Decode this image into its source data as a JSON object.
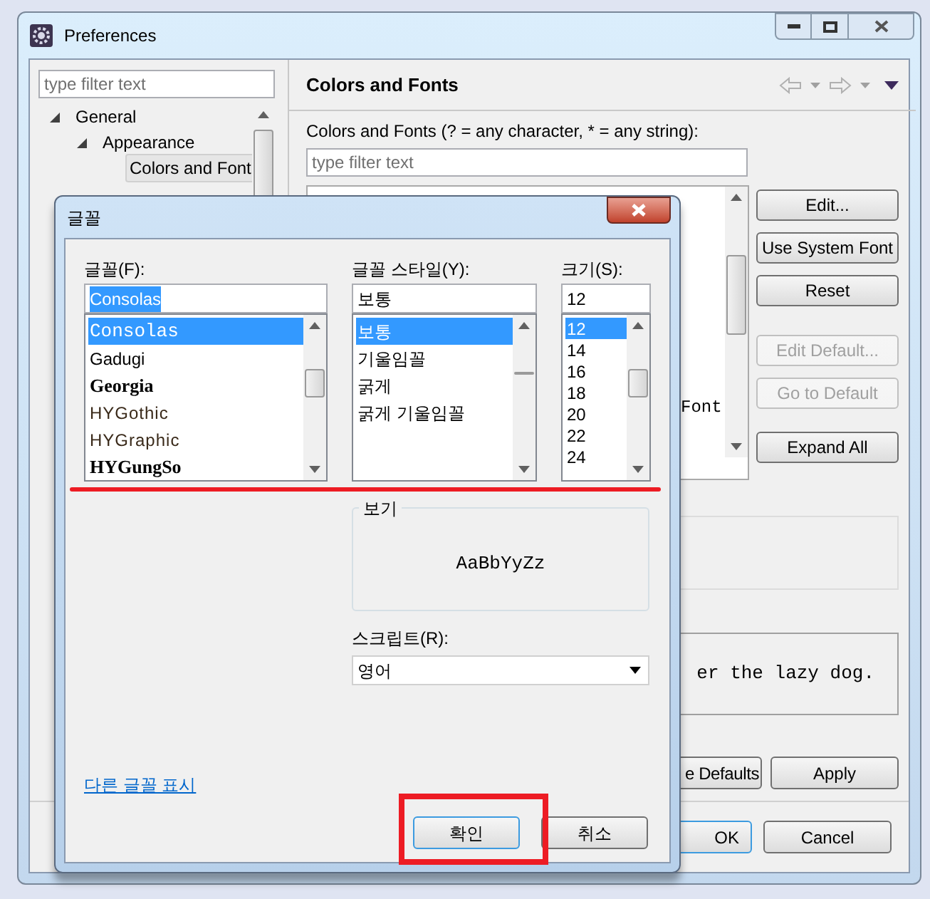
{
  "window": {
    "title": "Preferences"
  },
  "sidebar": {
    "filter_placeholder": "type filter text",
    "tree": [
      {
        "label": "General",
        "expanded": true,
        "selected": false,
        "children": [
          {
            "label": "Appearance",
            "expanded": true,
            "selected": false,
            "children": [
              {
                "label": "Colors and Font",
                "selected": true
              }
            ]
          }
        ]
      }
    ]
  },
  "page": {
    "title": "Colors and Fonts",
    "filter_label": "Colors and Fonts (? = any character, * = any string):",
    "filter_placeholder": "type filter text",
    "tree_fragment": "Font",
    "side_buttons": [
      {
        "label": "Edit...",
        "disabled": false
      },
      {
        "label": "Use System Font",
        "disabled": false
      },
      {
        "label": "Reset",
        "disabled": false
      },
      {
        "label": "Edit Default...",
        "disabled": true
      },
      {
        "label": "Go to Default",
        "disabled": true
      },
      {
        "label": "Expand All",
        "disabled": false
      }
    ],
    "preview_text": "er the lazy dog.",
    "footer_buttons": [
      {
        "label": "e Defaults",
        "default": false
      },
      {
        "label": "Apply",
        "default": false
      }
    ],
    "dialog_buttons": [
      {
        "label": "OK",
        "default": true
      },
      {
        "label": "Cancel",
        "default": false
      }
    ]
  },
  "font_dialog": {
    "title": "글꼴",
    "columns": [
      {
        "label": "글꼴(F):",
        "value": "Consolas",
        "value_selected": true,
        "items": [
          {
            "label": "Consolas",
            "kind": "mono",
            "selected": true
          },
          {
            "label": "Gadugi",
            "kind": "sans",
            "selected": false
          },
          {
            "label": "Georgia",
            "kind": "serif-bold",
            "selected": false
          },
          {
            "label": "HYGothic",
            "kind": "wide",
            "selected": false
          },
          {
            "label": "HYGraphic",
            "kind": "wide",
            "selected": false
          },
          {
            "label": "HYGungSo",
            "kind": "serif-bold",
            "selected": false
          }
        ]
      },
      {
        "label": "글꼴 스타일(Y):",
        "value": "보통",
        "value_selected": false,
        "items": [
          {
            "label": "보통",
            "kind": "sans",
            "selected": true
          },
          {
            "label": "기울임꼴",
            "kind": "sans",
            "selected": false
          },
          {
            "label": "굵게",
            "kind": "sans",
            "selected": false
          },
          {
            "label": "굵게 기울임꼴",
            "kind": "sans",
            "selected": false
          }
        ]
      },
      {
        "label": "크기(S):",
        "value": "12",
        "value_selected": false,
        "items": [
          {
            "label": "12",
            "kind": "sans",
            "selected": true
          },
          {
            "label": "14",
            "kind": "sans",
            "selected": false
          },
          {
            "label": "16",
            "kind": "sans",
            "selected": false
          },
          {
            "label": "18",
            "kind": "sans",
            "selected": false
          },
          {
            "label": "20",
            "kind": "sans",
            "selected": false
          },
          {
            "label": "22",
            "kind": "sans",
            "selected": false
          },
          {
            "label": "24",
            "kind": "sans",
            "selected": false
          }
        ]
      }
    ],
    "sample_label": "보기",
    "sample_text": "AaBbYyZz",
    "script_label": "스크립트(R):",
    "script_value": "영어",
    "link": "다른 글꼴 표시",
    "buttons": [
      {
        "label": "확인",
        "default": true
      },
      {
        "label": "취소",
        "default": false
      }
    ]
  }
}
